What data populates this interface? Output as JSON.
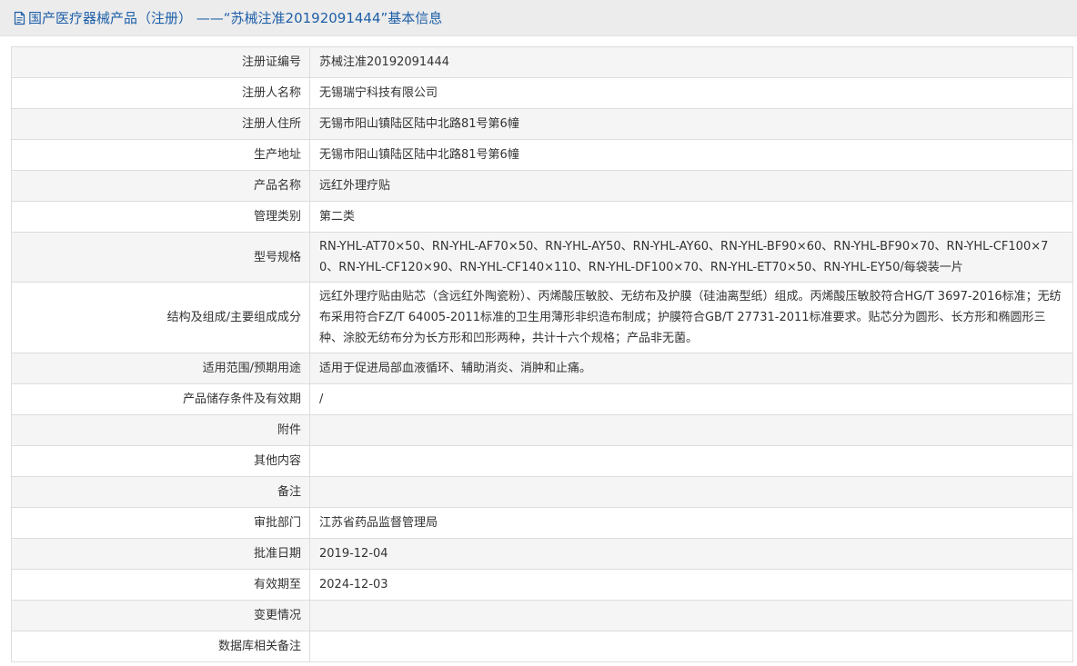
{
  "page": {
    "title": "国产医疗器械产品（注册） ——“苏械注准20192091444”基本信息",
    "accent_color": "#1e5fa8",
    "header_icon": "document-icon"
  },
  "rows": [
    {
      "label": "注册证编号",
      "value": "苏械注准20192091444"
    },
    {
      "label": "注册人名称",
      "value": "无锡瑞宁科技有限公司"
    },
    {
      "label": "注册人住所",
      "value": "无锡市阳山镇陆区陆中北路81号第6幢"
    },
    {
      "label": "生产地址",
      "value": "无锡市阳山镇陆区陆中北路81号第6幢"
    },
    {
      "label": "产品名称",
      "value": "远红外理疗贴"
    },
    {
      "label": "管理类别",
      "value": "第二类"
    },
    {
      "label": "型号规格",
      "value": "RN-YHL-AT70×50、RN-YHL-AF70×50、RN-YHL-AY50、RN-YHL-AY60、RN-YHL-BF90×60、RN-YHL-BF90×70、RN-YHL-CF100×70、RN-YHL-CF120×90、RN-YHL-CF140×110、RN-YHL-DF100×70、RN-YHL-ET70×50、RN-YHL-EY50/每袋装一片"
    },
    {
      "label": "结构及组成/主要组成成分",
      "value": "远红外理疗贴由贴芯（含远红外陶瓷粉）、丙烯酸压敏胶、无纺布及护膜（硅油离型纸）组成。丙烯酸压敏胶符合HG/T 3697-2016标准；无纺布采用符合FZ/T 64005-2011标准的卫生用薄形非织造布制成；护膜符合GB/T 27731-2011标准要求。贴芯分为圆形、长方形和椭圆形三种、涂胶无纺布分为长方形和凹形两种，共计十六个规格；产品非无菌。"
    },
    {
      "label": "适用范围/预期用途",
      "value": "适用于促进局部血液循环、辅助消炎、消肿和止痛。"
    },
    {
      "label": "产品储存条件及有效期",
      "value": "/"
    },
    {
      "label": "附件",
      "value": ""
    },
    {
      "label": "其他内容",
      "value": ""
    },
    {
      "label": "备注",
      "value": ""
    },
    {
      "label": "审批部门",
      "value": "江苏省药品监督管理局"
    },
    {
      "label": "批准日期",
      "value": "2019-12-04"
    },
    {
      "label": "有效期至",
      "value": "2024-12-03"
    },
    {
      "label": "变更情况",
      "value": ""
    },
    {
      "label": "数据库相关备注",
      "value": ""
    }
  ]
}
